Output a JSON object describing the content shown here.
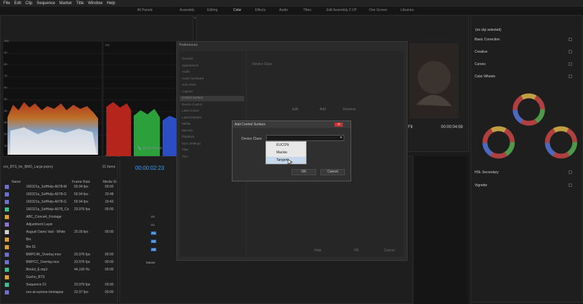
{
  "menu": [
    "File",
    "Edit",
    "Clip",
    "Sequence",
    "Marker",
    "Title",
    "Window",
    "Help"
  ],
  "workspaces": [
    "All Panels",
    "Assembly",
    "Editing",
    "Color",
    "Effects",
    "Audio",
    "Titles",
    "Edit Assembly 2 UP",
    "One Screen",
    "Libraries"
  ],
  "scopes": {
    "left_ticks": [
      "100",
      "90",
      "80",
      "70",
      "60",
      "50",
      "40",
      "30",
      "20",
      "10",
      "0"
    ],
    "right_ticks": [
      "100",
      "90",
      "80",
      "70",
      "60",
      "50",
      "40",
      "30",
      "20",
      "10",
      "0"
    ],
    "right_ticks_side": [
      "0.9",
      "0.8",
      "0.7",
      "0.6",
      "0.5",
      "0.4",
      "0.3",
      "0.2",
      "0.1",
      "0.0"
    ]
  },
  "project": {
    "title": "ers_BTS_for_BMD_Large.prproj",
    "items_count": "31 Items",
    "columns": [
      "Name",
      "Frame Rate",
      "Media St"
    ],
    "rows": [
      {
        "name": "160321a_SofHelp-A078-M",
        "rate": "59.94 fps",
        "media": "00:00",
        "color": "#6f6fd0"
      },
      {
        "name": "160321a_SofHelp-A078-G",
        "rate": "59.94 fps",
        "media": "20:48",
        "color": "#6f6fd0"
      },
      {
        "name": "160321a_SofHelp-A078-G",
        "rate": "59.94 fps",
        "media": "20:43",
        "color": "#6f6fd0"
      },
      {
        "name": "160321a_SofHelp-A078_Co",
        "rate": "23.976 fps",
        "media": "00:00",
        "color": "#3fbf8f"
      },
      {
        "name": "ABC_Concert_Footage",
        "rate": "",
        "media": "",
        "color": "#e0a030"
      },
      {
        "name": "Adjustment Layer",
        "rate": "",
        "media": "",
        "color": "#8f6fd0"
      },
      {
        "name": "August Dams Vad - White",
        "rate": "25.00 fps",
        "media": "00:00",
        "color": "#d0d0d0"
      },
      {
        "name": "Bin",
        "rate": "",
        "media": "",
        "color": "#e0a030"
      },
      {
        "name": "Bin 01",
        "rate": "",
        "media": "",
        "color": "#e0a030"
      },
      {
        "name": "BMPC4K_Overlay.mov",
        "rate": "23.976 fps",
        "media": "00:00",
        "color": "#6f6fd0"
      },
      {
        "name": "BMPCC_Overlay.mov",
        "rate": "23.976 fps",
        "media": "00:00",
        "color": "#6f6fd0"
      },
      {
        "name": "Bristol_E.mp3",
        "rate": "44,100 Hz",
        "media": "00:00",
        "color": "#3fbf8f"
      },
      {
        "name": "Gucho_BTS",
        "rate": "",
        "media": "",
        "color": "#e0a030"
      },
      {
        "name": "Sequence 01",
        "rate": "23.976 fps",
        "media": "00:00",
        "color": "#3fbf8f"
      },
      {
        "name": "ovs-at-sunrise-timelapse",
        "rate": "23.97 fps",
        "media": "00:00",
        "color": "#6f6fd0"
      }
    ]
  },
  "timeline": {
    "timecode": "00:00:02:23",
    "tracks": [
      "V2",
      "V1",
      "A1",
      "A2",
      "A3"
    ],
    "master": "Master"
  },
  "program": {
    "timecode": "00:00:04:08",
    "fit": "Fit"
  },
  "lumetri": {
    "clip": "(no clip selected)",
    "sections": [
      "Basic Correction",
      "Creative",
      "Curves",
      "Color Wheels",
      "HSL Secondary",
      "Vignette"
    ]
  },
  "prefs": {
    "title": "Preferences",
    "menu": [
      "General",
      "Appearance",
      "Audio",
      "Audio Hardware",
      "Auto Save",
      "Capture",
      "Control Surface",
      "Device Control",
      "Label Colors",
      "Label Defaults",
      "Media",
      "Memory",
      "Playback",
      "Sync Settings",
      "Titler",
      "Trim"
    ],
    "selected_index": 6,
    "device_class_label": "Device Class",
    "buttons": [
      "Edit",
      "Add",
      "Remove"
    ],
    "footer_buttons": [
      "Help",
      "OK",
      "Cancel"
    ]
  },
  "dialog": {
    "title": "Add Control Surface",
    "device_class_label": "Device Class:",
    "options": [
      "EUCON",
      "Mackie",
      "Tangent"
    ],
    "hovered_index": 2,
    "ok": "OK",
    "cancel": "Cancel"
  },
  "scope_label": "Clean Scope"
}
